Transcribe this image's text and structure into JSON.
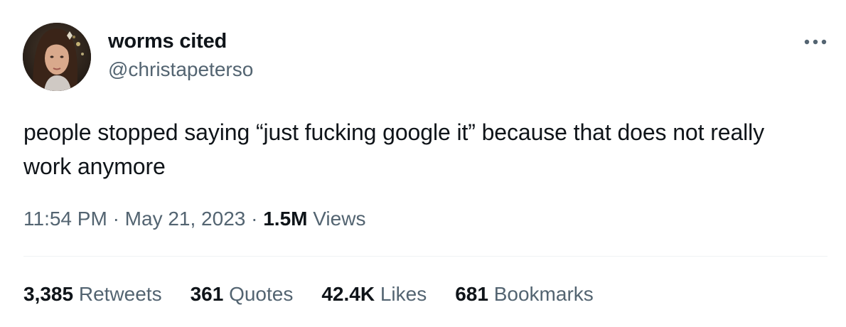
{
  "author": {
    "display_name": "worms cited",
    "handle": "@christapeterso"
  },
  "tweet": {
    "text": "people stopped saying “just fucking google it” because that does not really work anymore"
  },
  "meta": {
    "time": "11:54 PM",
    "separator": "·",
    "date": "May 21, 2023",
    "views_count": "1.5M",
    "views_label": "Views"
  },
  "stats": [
    {
      "count": "3,385",
      "label": "Retweets"
    },
    {
      "count": "361",
      "label": "Quotes"
    },
    {
      "count": "42.4K",
      "label": "Likes"
    },
    {
      "count": "681",
      "label": "Bookmarks"
    }
  ],
  "icons": {
    "more": "more-horizontal-icon",
    "avatar": "profile-photo"
  },
  "colors": {
    "primary_text": "#0f1419",
    "secondary_text": "#536471",
    "divider": "#eff3f4",
    "background": "#ffffff"
  }
}
